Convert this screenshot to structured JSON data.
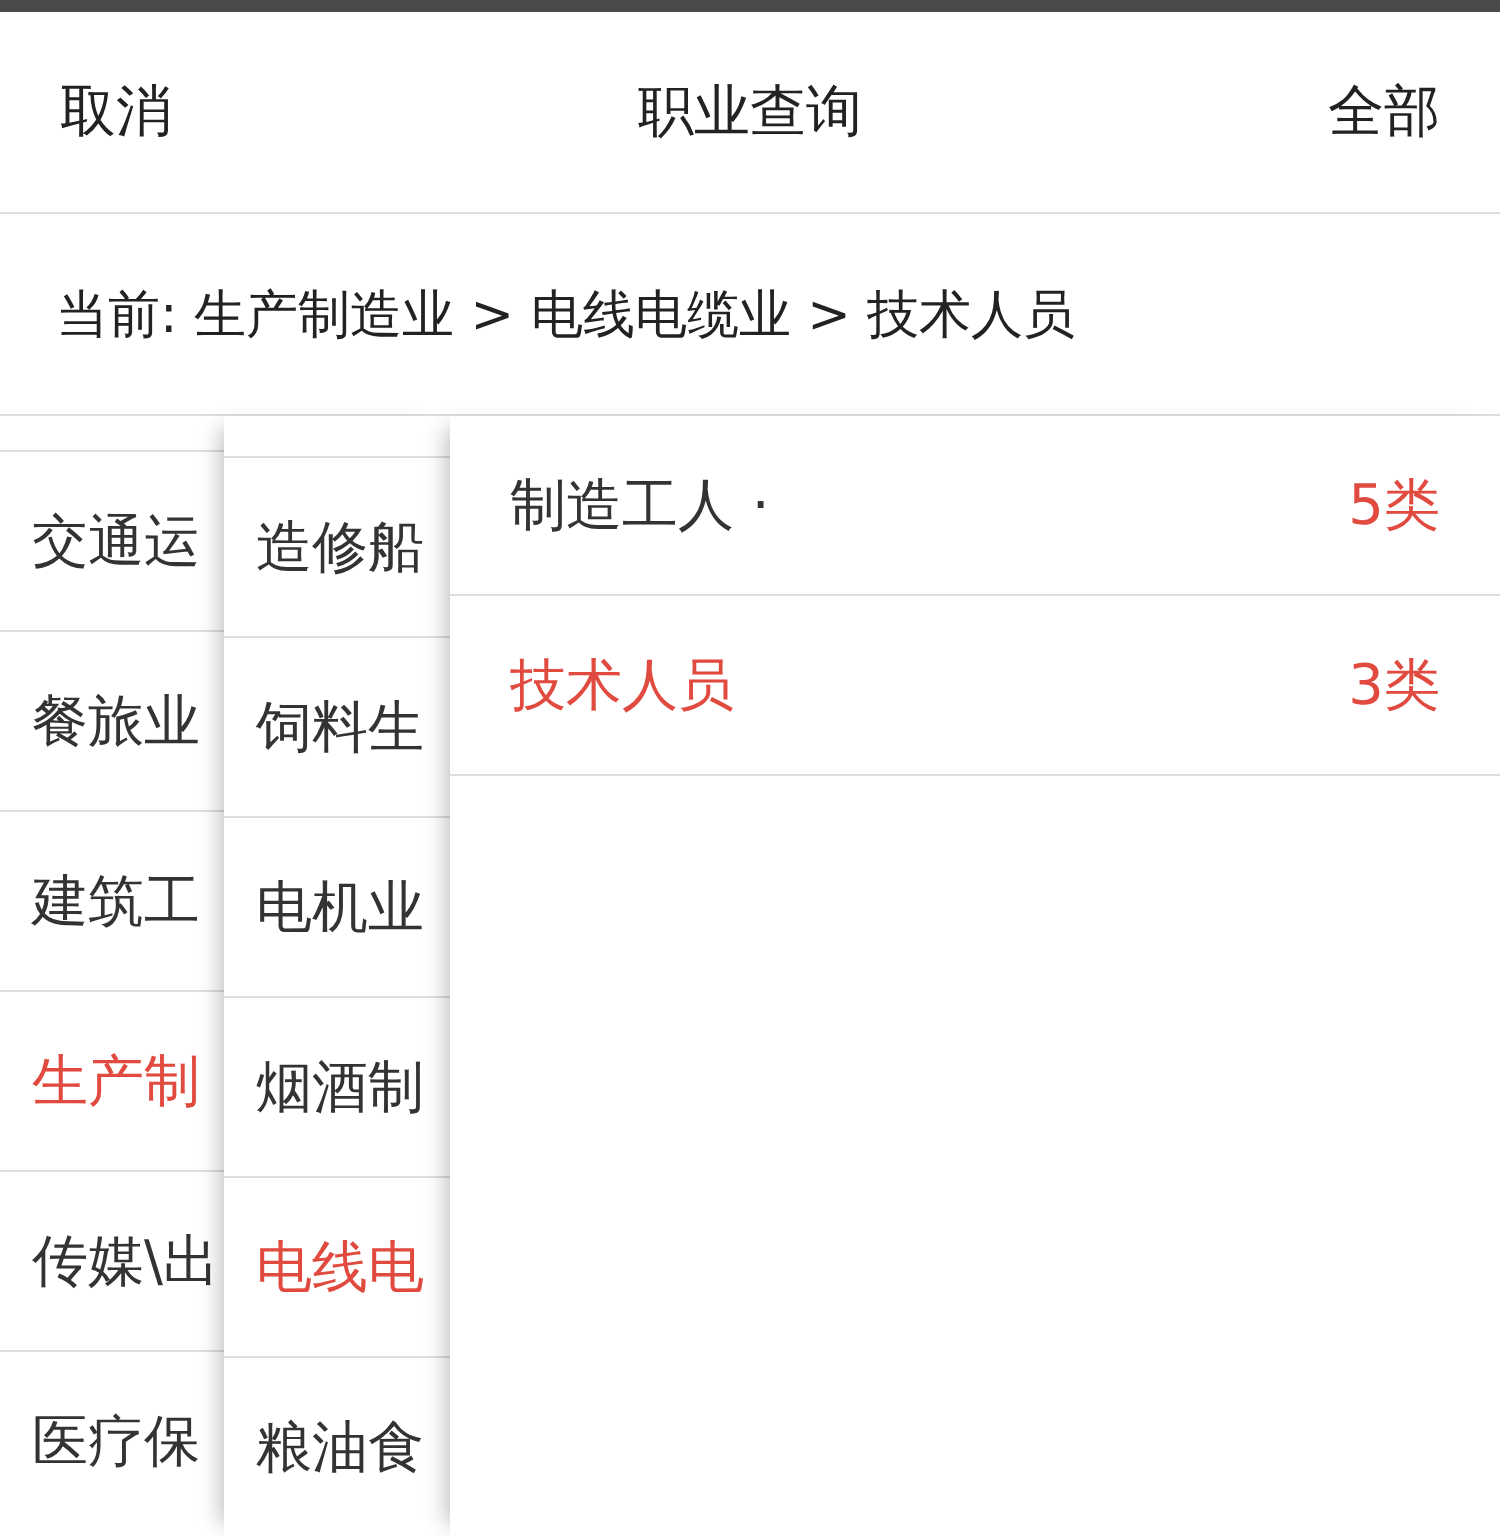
{
  "header": {
    "cancel": "取消",
    "title": "职业查询",
    "all": "全部"
  },
  "breadcrumb": "当前: 生产制造业 > 电线电缆业 > 技术人员",
  "column_1": [
    {
      "label": "交通运",
      "selected": false
    },
    {
      "label": "餐旅业",
      "selected": false
    },
    {
      "label": "建筑工",
      "selected": false
    },
    {
      "label": "生产制",
      "selected": true
    },
    {
      "label": "传媒\\出",
      "selected": false
    },
    {
      "label": "医疗保",
      "selected": false
    }
  ],
  "column_2": [
    {
      "label": "造修船",
      "selected": false
    },
    {
      "label": "饲料生",
      "selected": false
    },
    {
      "label": "电机业",
      "selected": false
    },
    {
      "label": "烟酒制",
      "selected": false
    },
    {
      "label": "电线电",
      "selected": true
    },
    {
      "label": "粮油食",
      "selected": false
    }
  ],
  "column_3": [
    {
      "label": "制造工人 ·",
      "count": "5类",
      "selected": false
    },
    {
      "label": "技术人员",
      "count": "3类",
      "selected": true
    }
  ]
}
